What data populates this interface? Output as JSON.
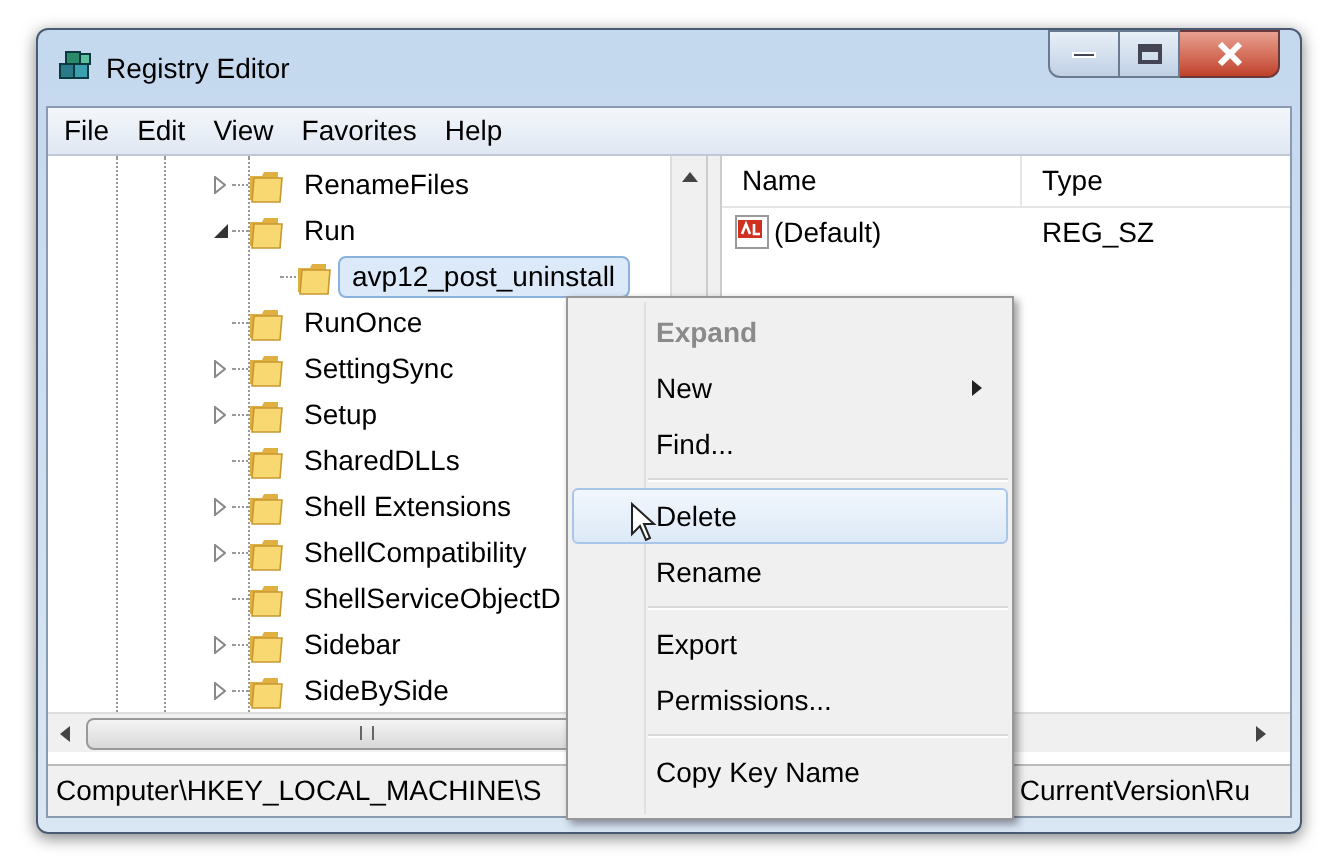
{
  "window": {
    "title": "Registry Editor"
  },
  "menu_bar": [
    "File",
    "Edit",
    "View",
    "Favorites",
    "Help"
  ],
  "tree": [
    {
      "label": "RenameFiles",
      "kind": "collapsed",
      "selected": false
    },
    {
      "label": "Run",
      "kind": "expanded",
      "selected": false,
      "children": [
        {
          "label": "avp12_post_uninstall",
          "kind": "leaf",
          "selected": true
        }
      ]
    },
    {
      "label": "RunOnce",
      "kind": "leaf",
      "selected": false
    },
    {
      "label": "SettingSync",
      "kind": "collapsed",
      "selected": false
    },
    {
      "label": "Setup",
      "kind": "collapsed",
      "selected": false
    },
    {
      "label": "SharedDLLs",
      "kind": "leaf",
      "selected": false
    },
    {
      "label": "Shell Extensions",
      "kind": "collapsed",
      "selected": false
    },
    {
      "label": "ShellCompatibility",
      "kind": "collapsed",
      "selected": false
    },
    {
      "label": "ShellServiceObjectD",
      "kind": "leaf",
      "selected": false
    },
    {
      "label": "Sidebar",
      "kind": "collapsed",
      "selected": false
    },
    {
      "label": "SideBySide",
      "kind": "collapsed",
      "selected": false
    }
  ],
  "values": {
    "columns": [
      "Name",
      "Type"
    ],
    "rows": [
      {
        "name": "(Default)",
        "type": "REG_SZ"
      }
    ]
  },
  "context_menu": [
    {
      "kind": "item",
      "label": "Expand",
      "default": true,
      "disabled": true,
      "selected": false
    },
    {
      "kind": "item",
      "label": "New",
      "submenu": true,
      "disabled": false,
      "selected": false
    },
    {
      "kind": "item",
      "label": "Find...",
      "disabled": false,
      "selected": false
    },
    {
      "kind": "separator"
    },
    {
      "kind": "item",
      "label": "Delete",
      "disabled": false,
      "selected": true
    },
    {
      "kind": "item",
      "label": "Rename",
      "disabled": false,
      "selected": false
    },
    {
      "kind": "separator"
    },
    {
      "kind": "item",
      "label": "Export",
      "disabled": false,
      "selected": false
    },
    {
      "kind": "item",
      "label": "Permissions...",
      "disabled": false,
      "selected": false
    },
    {
      "kind": "separator"
    },
    {
      "kind": "item",
      "label": "Copy Key Name",
      "disabled": false,
      "selected": false
    }
  ],
  "status_bar": [
    "Computer\\HKEY_LOCAL_MACHINE\\S",
    "CurrentVersion\\Ru"
  ]
}
